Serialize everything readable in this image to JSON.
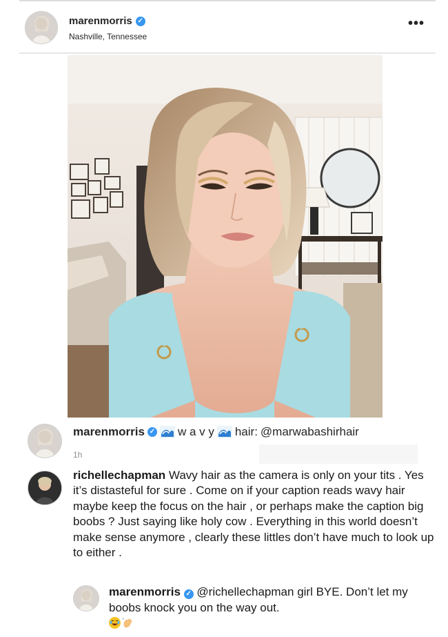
{
  "post": {
    "username": "marenmorris",
    "location": "Nashville, Tennessee",
    "more_label": "•••"
  },
  "caption": {
    "username": "marenmorris",
    "text_a": "w a v y",
    "text_b": "hair:",
    "mention": "@marwabashirhair",
    "time": "1h"
  },
  "comments": [
    {
      "username": "richellechapman",
      "text": "Wavy hair as the camera is only on your tits . Yes it’s distasteful for sure . Come on if your caption reads wavy hair maybe keep the focus on the hair , or perhaps make the caption big boobs ? Just saying like holy cow . Everything in this world doesn’t make sense anymore , clearly these littles don’t have much to look up to either ."
    }
  ],
  "reply": {
    "username": "marenmorris",
    "mention": "@richellechapman",
    "text": "girl BYE. Don’t let my boobs knock you on the way out."
  },
  "colors": {
    "verified": "#3897f0",
    "top_wear": "#9fd6df",
    "wall": "#efe8e2"
  },
  "icons": {
    "verified": "verified-badge-icon",
    "more": "more-options-icon",
    "wave": "water-wave-emoji-icon",
    "laugh": "tears-of-joy-emoji-icon",
    "wave_hand": "waving-hand-emoji-icon"
  }
}
